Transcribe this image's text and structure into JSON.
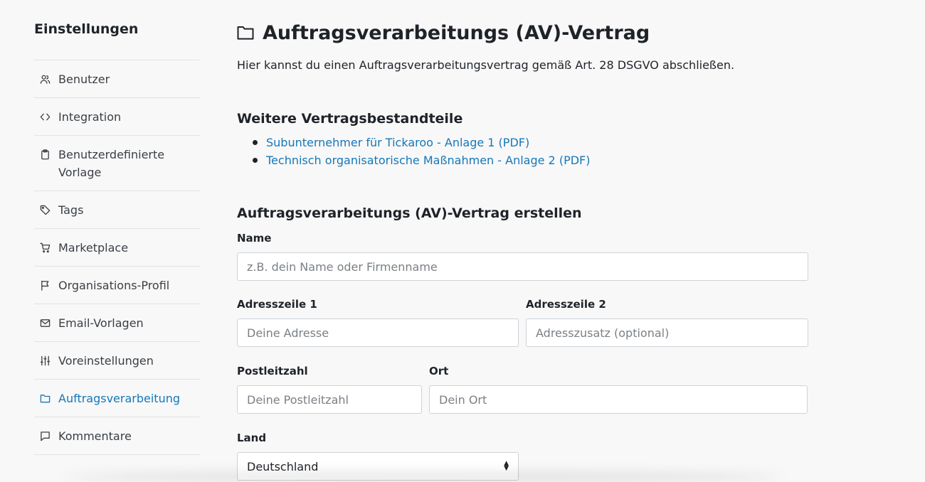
{
  "sidebar": {
    "title": "Einstellungen",
    "items": [
      {
        "label": "Benutzer",
        "icon": "users-icon",
        "active": false
      },
      {
        "label": "Integration",
        "icon": "code-icon",
        "active": false
      },
      {
        "label": "Benutzerdefinierte Vorlage",
        "icon": "clipboard-icon",
        "active": false
      },
      {
        "label": "Tags",
        "icon": "tag-icon",
        "active": false
      },
      {
        "label": "Marketplace",
        "icon": "cart-icon",
        "active": false
      },
      {
        "label": "Organisations-Profil",
        "icon": "flag-icon",
        "active": false
      },
      {
        "label": "Email-Vorlagen",
        "icon": "mail-icon",
        "active": false
      },
      {
        "label": "Voreinstellungen",
        "icon": "sliders-icon",
        "active": false
      },
      {
        "label": "Auftragsverarbeitung",
        "icon": "folder-icon",
        "active": true
      },
      {
        "label": "Kommentare",
        "icon": "comment-icon",
        "active": false
      }
    ]
  },
  "main": {
    "title": "Auftragsverarbeitungs (AV)-Vertrag",
    "intro": "Hier kannst du einen Auftragsverarbeitungsvertrag gemäß Art. 28 DSGVO abschließen.",
    "docs_heading": "Weitere Vertragsbestandteile",
    "docs": [
      "Subunternehmer für Tickaroo - Anlage 1 (PDF)",
      "Technisch organisatorische Maßnahmen - Anlage 2 (PDF)"
    ],
    "form_heading": "Auftragsverarbeitungs (AV)-Vertrag erstellen",
    "form": {
      "name_label": "Name",
      "name_placeholder": "z.B. dein Name oder Firmenname",
      "addr1_label": "Adresszeile 1",
      "addr1_placeholder": "Deine Adresse",
      "addr2_label": "Adresszeile 2",
      "addr2_placeholder": "Adresszusatz (optional)",
      "zip_label": "Postleitzahl",
      "zip_placeholder": "Deine Postleitzahl",
      "city_label": "Ort",
      "city_placeholder": "Dein Ort",
      "country_label": "Land",
      "country_value": "Deutschland"
    }
  },
  "colors": {
    "accent": "#1677b8",
    "background": "#f8f8f8",
    "text": "#1f2328",
    "border": "#cfd3d7"
  }
}
